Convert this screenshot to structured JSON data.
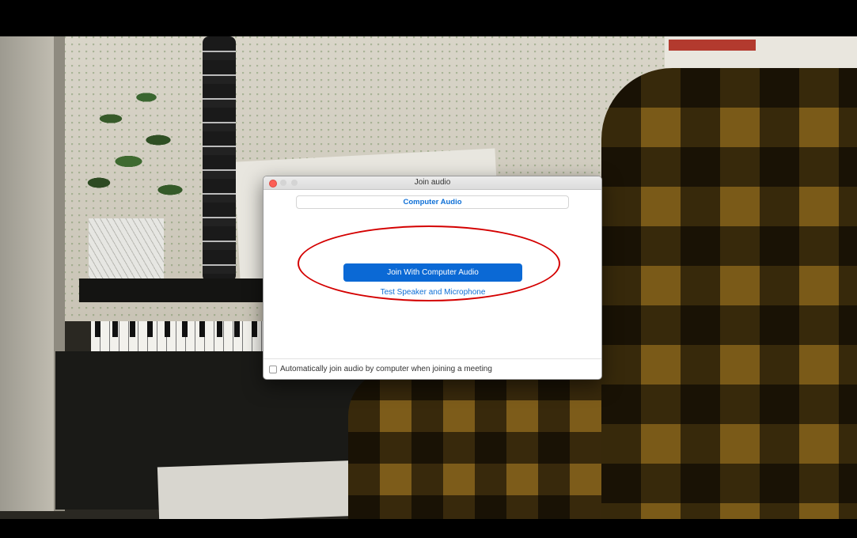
{
  "window": {
    "title": "Join audio"
  },
  "tabs": [
    {
      "label": "Computer Audio"
    }
  ],
  "main": {
    "join_button_label": "Join With Computer Audio",
    "test_link_label": "Test Speaker and Microphone"
  },
  "footer": {
    "auto_join_label": "Automatically join audio by computer when joining a meeting",
    "auto_join_checked": false
  },
  "colors": {
    "accent": "#0b69d5",
    "highlight": "#d40000"
  },
  "icons": {
    "close": "close-icon",
    "minimize": "minimize-icon",
    "maximize": "maximize-icon"
  }
}
